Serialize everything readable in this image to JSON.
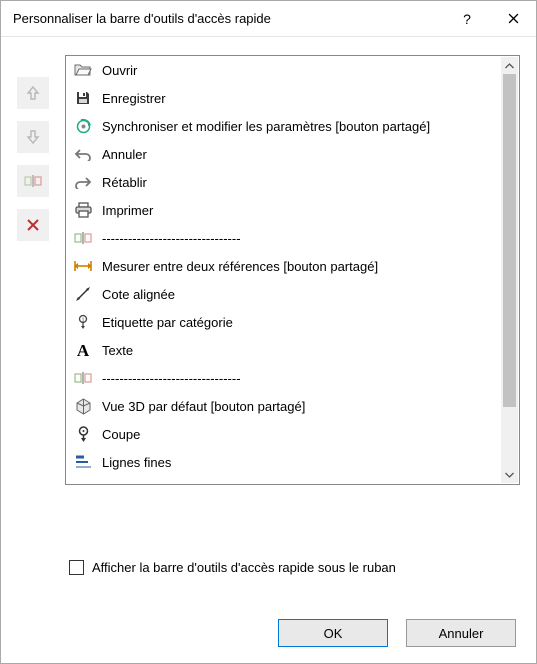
{
  "dialog": {
    "title": "Personnaliser la barre d'outils d'accès rapide"
  },
  "commands": {
    "labels": {
      "ouvrir": "Ouvrir",
      "enregistrer": "Enregistrer",
      "sync": "Synchroniser et modifier les paramètres [bouton partagé]",
      "annuler": "Annuler",
      "retablir": "Rétablir",
      "imprimer": "Imprimer",
      "sep": "--------------------------------",
      "mesurer": "Mesurer entre deux références [bouton partagé]",
      "cote": "Cote alignée",
      "etiquette": "Etiquette par catégorie",
      "texte": "Texte",
      "vue3d": "Vue 3D par défaut [bouton partagé]",
      "coupe": "Coupe",
      "lignes": "Lignes fines"
    }
  },
  "checkbox": {
    "label": "Afficher la barre d'outils d'accès rapide sous le ruban"
  },
  "buttons": {
    "ok": "OK",
    "cancel": "Annuler"
  }
}
